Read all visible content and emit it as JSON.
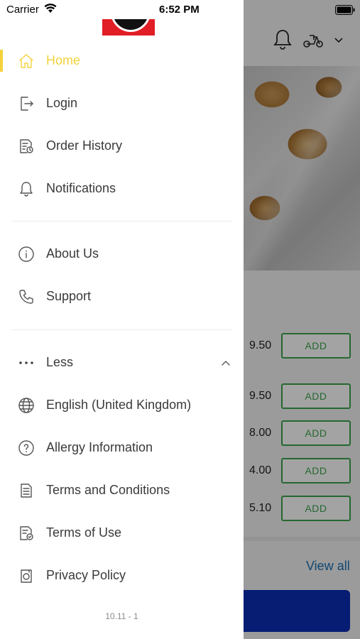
{
  "status_bar": {
    "carrier": "Carrier",
    "time": "6:52 PM"
  },
  "colors": {
    "accent": "#f4d23c",
    "brand_red": "#e11d25",
    "add_green": "#3aa34b",
    "link_blue": "#1a6fb3",
    "primary_button": "#0b2db5"
  },
  "drawer": {
    "menu_primary": [
      {
        "label": "Home",
        "icon": "home-icon",
        "active": true
      },
      {
        "label": "Login",
        "icon": "login-icon"
      },
      {
        "label": "Order History",
        "icon": "order-history-icon"
      },
      {
        "label": "Notifications",
        "icon": "bell-icon"
      }
    ],
    "menu_info": [
      {
        "label": "About Us",
        "icon": "info-icon"
      },
      {
        "label": "Support",
        "icon": "phone-icon"
      }
    ],
    "less_toggle": {
      "label": "Less",
      "icon": "more-dots-icon",
      "expanded": true
    },
    "menu_more": [
      {
        "label": "English (United Kingdom)",
        "icon": "globe-icon"
      },
      {
        "label": "Allergy Information",
        "icon": "question-icon"
      },
      {
        "label": "Terms and Conditions",
        "icon": "document-icon"
      },
      {
        "label": "Terms of Use",
        "icon": "document-check-icon"
      },
      {
        "label": "Privacy Policy",
        "icon": "privacy-icon"
      }
    ],
    "version": "10.11 - 1"
  },
  "background": {
    "header_icons": [
      "bell-icon",
      "scooter-icon",
      "chevron-down-icon"
    ],
    "items": [
      {
        "price": "9.50",
        "add_label": "ADD"
      },
      {
        "price": "9.50",
        "add_label": "ADD"
      },
      {
        "price": "8.00",
        "add_label": "ADD"
      },
      {
        "price": "4.00",
        "add_label": "ADD"
      },
      {
        "price": "5.10",
        "add_label": "ADD"
      }
    ],
    "view_all": "View all"
  }
}
